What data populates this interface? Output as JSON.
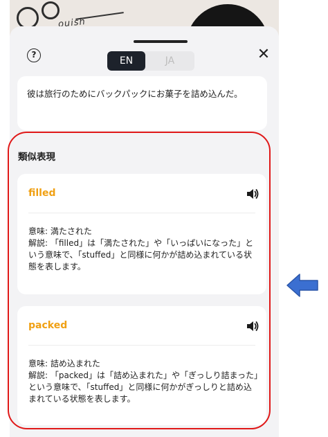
{
  "header": {
    "help_icon_glyph": "?",
    "language_toggle": {
      "selected": "EN",
      "other": "JA"
    },
    "close_icon_glyph": "✕"
  },
  "example": {
    "sentence": "彼は旅行のためにバックパックにお菓子を詰め込んだ。"
  },
  "similar": {
    "title": "類似表現",
    "items": [
      {
        "word": "filled",
        "meaning": "意味: 満たされた",
        "explanation": "解説: 「filled」は「満たされた」や「いっぱいになった」という意味で、「stuffed」と同様に何かが詰め込まれている状態を表します。"
      },
      {
        "word": "packed",
        "meaning": "意味: 詰め込まれた",
        "explanation": "解説: 「packed」は「詰め込まれた」や「ぎっしり詰まった」という意味で、「stuffed」と同様に何かがぎっしりと詰め込まれている状態を表します。"
      }
    ]
  },
  "background_text": "ouish",
  "colors": {
    "accent_word": "#f0a013",
    "annotation_outline": "#e01818",
    "annotation_arrow": "#3b6fd1",
    "toggle_active_bg": "#1d222b"
  }
}
